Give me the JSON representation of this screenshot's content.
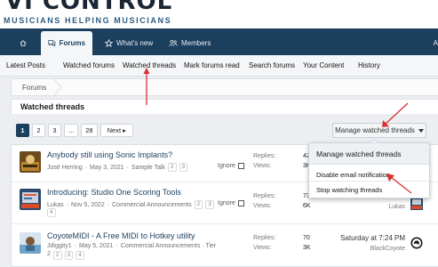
{
  "brand": {
    "logo_text": "VI CONTROL",
    "tagline": "MUSICIANS HELPING MUSICIANS"
  },
  "nav": {
    "tabs": [
      {
        "label": "Forums",
        "icon": "chat-icon"
      },
      {
        "label": "What's new",
        "icon": "star-icon"
      },
      {
        "label": "Members",
        "icon": "users-icon"
      }
    ],
    "edge_glyph": "A"
  },
  "subnav": {
    "items": [
      "Latest Posts",
      "Watched forums",
      "Watched threads",
      "Mark forums read",
      "Search forums",
      "Your Content",
      "History"
    ]
  },
  "breadcrumb": {
    "item": "Forums"
  },
  "page": {
    "title": "Watched threads"
  },
  "pagination": {
    "pages": [
      "1",
      "2",
      "3",
      "...",
      "28"
    ],
    "current": "1",
    "next_label": "Next ▸"
  },
  "manage": {
    "label": "Manage watched threads",
    "menu_title": "Manage watched threads",
    "menu_items": [
      "Disable email notification",
      "Stop watching threads"
    ]
  },
  "threads": [
    {
      "title": "Anybody still using Sonic Implants?",
      "author": "José Herring",
      "date": "May 3, 2021",
      "forum": "Sample Talk",
      "pages": [
        "2",
        "3"
      ],
      "ignore_label": "Ignore",
      "replies_label": "Replies:",
      "views_label": "Views:",
      "replies": "42",
      "views": "3K"
    },
    {
      "title": "Introducing: Studio One Scoring Tools",
      "author": "Lukas",
      "date": "Nov 5, 2022",
      "forum": "Commercial Announcements",
      "pages": [
        "2",
        "3"
      ],
      "pages_wrap": [
        "4"
      ],
      "ignore_label": "Ignore",
      "replies_label": "Replies:",
      "views_label": "Views:",
      "replies": "73",
      "views": "6K",
      "last_user": "Lukas"
    },
    {
      "title": "CoyoteMIDI - A Free MIDI to Hotkey utility",
      "author": "Jdiggity1",
      "date": "May 5, 2021",
      "forum": "Commercial Announcements · Tier",
      "pages_wrap": [
        "2",
        "3",
        "4"
      ],
      "pages_wrap_prefix": "2",
      "replies_label": "Replies:",
      "views_label": "Views:",
      "replies": "70",
      "views": "3K",
      "last_date": "Saturday at 7:24 PM",
      "last_user": "BlackCoyote"
    }
  ],
  "colors": {
    "navbar": "#1c3f5e",
    "accent_link": "#1c3f5e",
    "annotation_arrow": "#d93030"
  }
}
